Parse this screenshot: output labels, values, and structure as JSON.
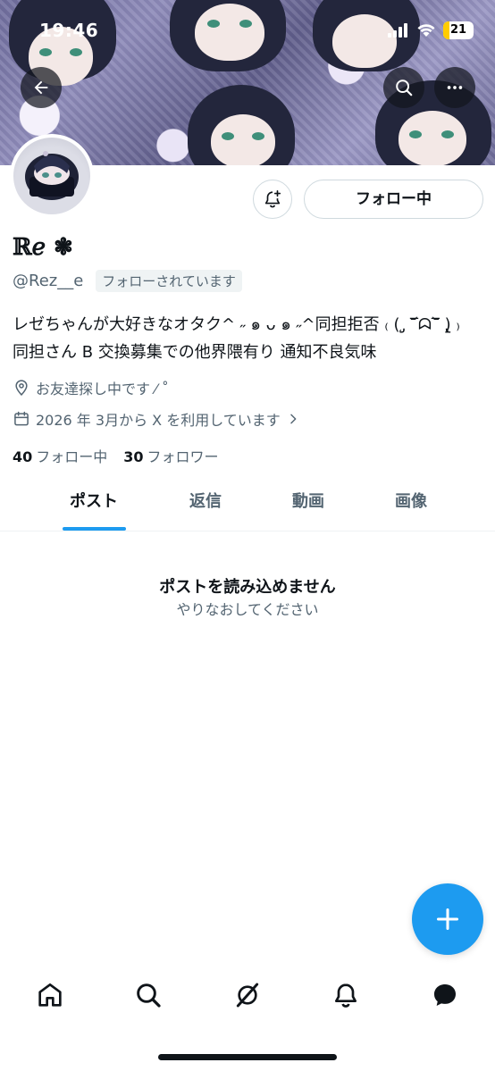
{
  "status_bar": {
    "time": "19:46",
    "battery": "21",
    "battery_level": 0.21,
    "icons": [
      "signal-icon",
      "wifi-icon",
      "battery-icon"
    ]
  },
  "header": {
    "back_icon": "arrow-left-icon",
    "search_icon": "search-icon",
    "more_icon": "more-horizontal-icon"
  },
  "profile": {
    "display_name": "ℝℯ ❃",
    "handle": "@Rez__e",
    "follows_you": "フォローされています",
    "follow_button": "フォロー中",
    "notify_icon": "bell-plus-icon",
    "bio_line1": "レゼちゃんが大好きなオタク^ ˶ ๑ ᴗ ๑ ˶^同担拒否 ₍ ( ̨̡ ‾᷄ᗣ‾᷅ )̧̢ ₎",
    "bio_line2": "同担さん B 交換募集での他界隈有り 通知不良気味",
    "location": "お友達探し中です ⁄ ˚",
    "joined": "2026 年 3月から X を利用しています",
    "following_count": "40",
    "following_label": "フォロー中",
    "followers_count": "30",
    "followers_label": "フォロワー"
  },
  "tabs": [
    {
      "label": "ポスト",
      "active": true
    },
    {
      "label": "返信",
      "active": false
    },
    {
      "label": "動画",
      "active": false
    },
    {
      "label": "画像",
      "active": false
    }
  ],
  "empty_state": {
    "title": "ポストを読み込めません",
    "subtitle": "やりなおしてください"
  },
  "fab_icon": "plus-icon",
  "bottom_nav": [
    "home-icon",
    "search-icon",
    "grok-icon",
    "notifications-icon",
    "messages-icon"
  ],
  "colors": {
    "accent": "#1d9bf0",
    "text_primary": "#0f1419",
    "text_secondary": "#536471",
    "border": "#cfd9de"
  }
}
